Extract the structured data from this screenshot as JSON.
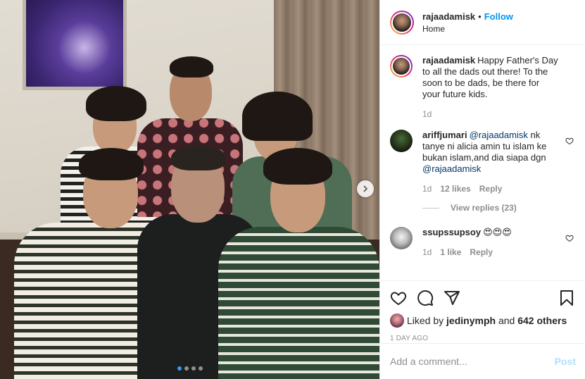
{
  "header": {
    "username": "rajaadamisk",
    "separator": "•",
    "follow_label": "Follow",
    "location": "Home"
  },
  "caption": {
    "username": "rajaadamisk",
    "text": "Happy Father's Day to all the dads out there! To the soon to be dads, be there for your future kids.",
    "time": "1d"
  },
  "comments": [
    {
      "username": "ariffjumari",
      "mention1": "@rajaadamisk",
      "text": "nk tanye ni alicia amin tu islam ke bukan islam,and dia siapa dgn",
      "mention2": "@rajaadamisk",
      "time": "1d",
      "likes": "12 likes",
      "reply_label": "Reply",
      "view_replies": "View replies (23)"
    },
    {
      "username": "ssupssupsoy",
      "text": "😍😍😍",
      "time": "1d",
      "likes": "1 like",
      "reply_label": "Reply"
    }
  ],
  "likes": {
    "prefix": "Liked by",
    "user": "jedinymph",
    "and": "and",
    "others": "642 others"
  },
  "timestamp": "1 DAY AGO",
  "add_comment": {
    "placeholder": "Add a comment...",
    "post_label": "Post"
  },
  "carousel": {
    "total": 4,
    "active_index": 0
  },
  "icons": [
    "chevron-right-icon",
    "heart-icon",
    "comment-icon",
    "share-icon",
    "bookmark-icon"
  ],
  "colors": {
    "accent": "#0095f6",
    "muted": "#8e8e8e",
    "mention": "#00376b",
    "post_disabled": "#b2dffc"
  }
}
